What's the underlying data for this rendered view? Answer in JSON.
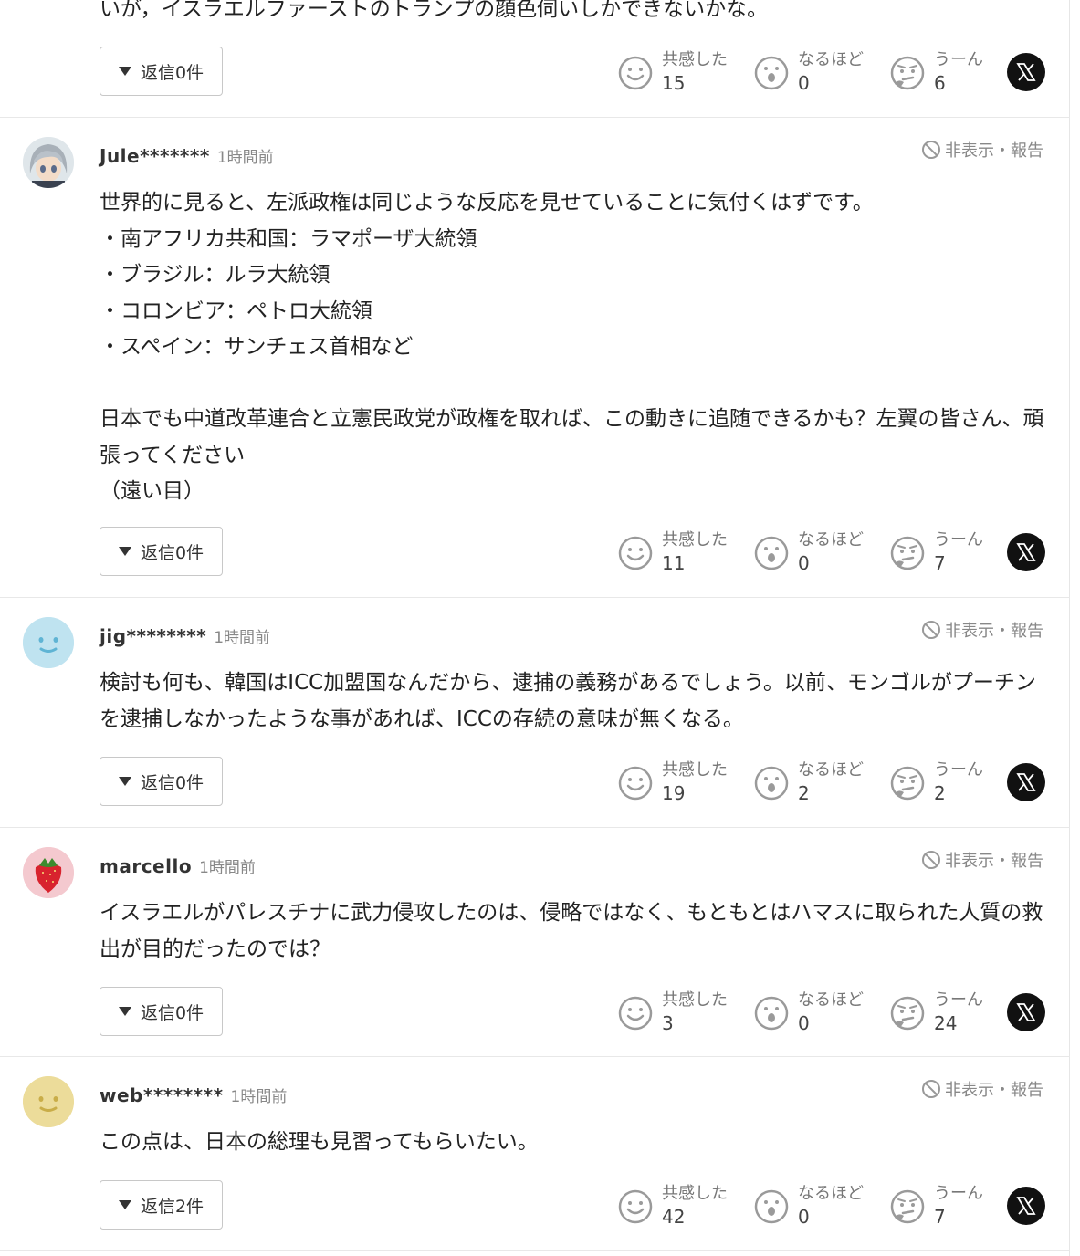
{
  "top_partial": {
    "text": "いが，イスラエルファーストのトランプの顔色伺いしかできないかな。",
    "reply_label": "返信0件",
    "reactions": {
      "empathy_label": "共感した",
      "empathy": "15",
      "insight_label": "なるほど",
      "insight": "0",
      "hmm_label": "うーん",
      "hmm": "6"
    }
  },
  "report_label": "非表示・報告",
  "comments": [
    {
      "user": "Jule*******",
      "time": "1時間前",
      "text": "世界的に見ると、左派政権は同じような反応を見せていることに気付くはずです。\n・南アフリカ共和国：ラマポーザ大統領\n・ブラジル：ルラ大統領\n・コロンビア：ペトロ大統領\n・スペイン：サンチェス首相など\n\n日本でも中道改革連合と立憲民政党が政権を取れば、この動きに追随できるかも？左翼の皆さん、頑張ってください\n（遠い目）",
      "reply_label": "返信0件",
      "reactions": {
        "empathy_label": "共感した",
        "empathy": "11",
        "insight_label": "なるほど",
        "insight": "0",
        "hmm_label": "うーん",
        "hmm": "7"
      }
    },
    {
      "user": "jig********",
      "time": "1時間前",
      "text": "検討も何も、韓国はICC加盟国なんだから、逮捕の義務があるでしょう。以前、モンゴルがプーチンを逮捕しなかったような事があれば、ICCの存続の意味が無くなる。",
      "reply_label": "返信0件",
      "reactions": {
        "empathy_label": "共感した",
        "empathy": "19",
        "insight_label": "なるほど",
        "insight": "2",
        "hmm_label": "うーん",
        "hmm": "2"
      }
    },
    {
      "user": "marcello",
      "time": "1時間前",
      "text": "イスラエルがパレスチナに武力侵攻したのは、侵略ではなく、もともとはハマスに取られた人質の救出が目的だったのでは？",
      "reply_label": "返信0件",
      "reactions": {
        "empathy_label": "共感した",
        "empathy": "3",
        "insight_label": "なるほど",
        "insight": "0",
        "hmm_label": "うーん",
        "hmm": "24"
      }
    },
    {
      "user": "web********",
      "time": "1時間前",
      "text": "この点は、日本の総理も見習ってもらいたい。",
      "reply_label": "返信2件",
      "reactions": {
        "empathy_label": "共感した",
        "empathy": "42",
        "insight_label": "なるほど",
        "insight": "0",
        "hmm_label": "うーん",
        "hmm": "7"
      }
    }
  ],
  "colors": {
    "accent_dark": "#111111",
    "icon_gray": "#9a9a9a",
    "border": "#e8e8e8"
  }
}
